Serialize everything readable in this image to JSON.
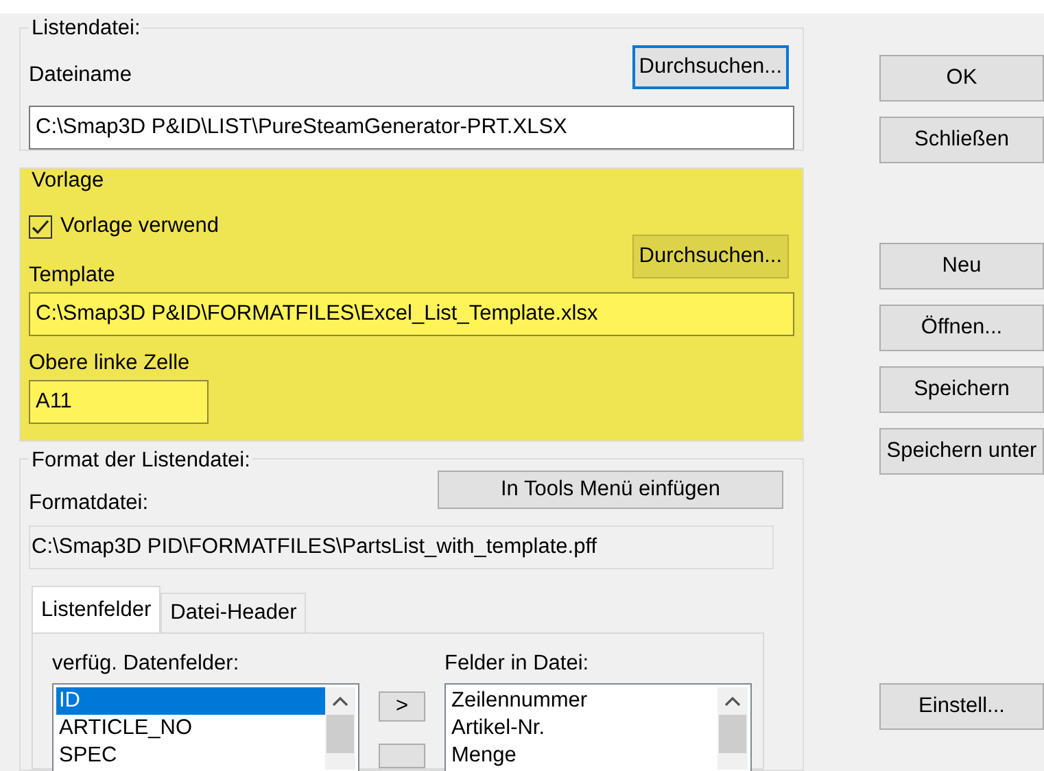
{
  "list_file": {
    "legend": "Listendatei:",
    "label": "Dateiname",
    "browse_button": {
      "label": "Durchsuchen...",
      "focused": true
    },
    "value": "C:\\Smap3D P&ID\\LIST\\PureSteamGenerator-PRT.XLSX"
  },
  "template": {
    "legend": "Vorlage",
    "highlighted": true,
    "checkbox": {
      "label": "Vorlage verwend",
      "checked": true
    },
    "browse_button": {
      "label": "Durchsuchen...",
      "focused": false
    },
    "template_label": "Template",
    "template_value": "C:\\Smap3D P&ID\\FORMATFILES\\Excel_List_Template.xlsx",
    "cell_label": "Obere linke Zelle",
    "cell_value": "A11"
  },
  "format": {
    "legend": "Format der Listendatei:",
    "formatfile_label": "Formatdatei:",
    "tools_button": "In Tools Menü einfügen",
    "formatfile_value": "C:\\Smap3D PID\\FORMATFILES\\PartsList_with_template.pff",
    "tabs": [
      {
        "label": "Listenfelder",
        "selected": true
      },
      {
        "label": "Datei-Header",
        "selected": false
      }
    ],
    "available_label": "verfüg. Datenfelder:",
    "available_items": [
      {
        "label": "ID",
        "selected": true
      },
      {
        "label": "ARTICLE_NO",
        "selected": false
      },
      {
        "label": "SPEC",
        "selected": false
      }
    ],
    "add_button": ">",
    "file_label": "Felder in Datei:",
    "file_items": [
      {
        "label": "Zeilennummer",
        "selected": false
      },
      {
        "label": "Artikel-Nr.",
        "selected": false
      },
      {
        "label": "Menge",
        "selected": false
      }
    ]
  },
  "button_groups": [
    [
      "OK",
      "Schließen"
    ],
    [
      "Neu",
      "Öffnen...",
      "Speichern",
      "Speichern unter"
    ],
    [
      "Einstell..."
    ]
  ]
}
